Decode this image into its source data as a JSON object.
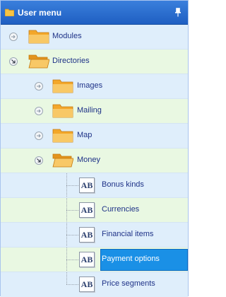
{
  "header": {
    "title": "User menu",
    "icon": "folder-icon",
    "pin_icon": "pin-icon"
  },
  "tree": {
    "modules": {
      "label": "Modules",
      "state": "collapsed"
    },
    "directories": {
      "label": "Directories",
      "state": "expanded"
    },
    "images": {
      "label": "Images",
      "state": "collapsed"
    },
    "mailing": {
      "label": "Mailing",
      "state": "collapsed"
    },
    "map": {
      "label": "Map",
      "state": "collapsed"
    },
    "money": {
      "label": "Money",
      "state": "expanded"
    },
    "items": [
      {
        "label": "Bonus kinds",
        "icon": "AB"
      },
      {
        "label": "Currencies",
        "icon": "AB"
      },
      {
        "label": "Financial items",
        "icon": "AB"
      },
      {
        "label": "Payment options",
        "icon": "AB",
        "selected": true
      },
      {
        "label": "Price segments",
        "icon": "AB"
      }
    ]
  },
  "colors": {
    "header": "#2a6fd0",
    "selected": "#1a90e6",
    "row_blue": "#dfeefb",
    "row_green": "#e9f8e2",
    "text": "#1e3287"
  }
}
